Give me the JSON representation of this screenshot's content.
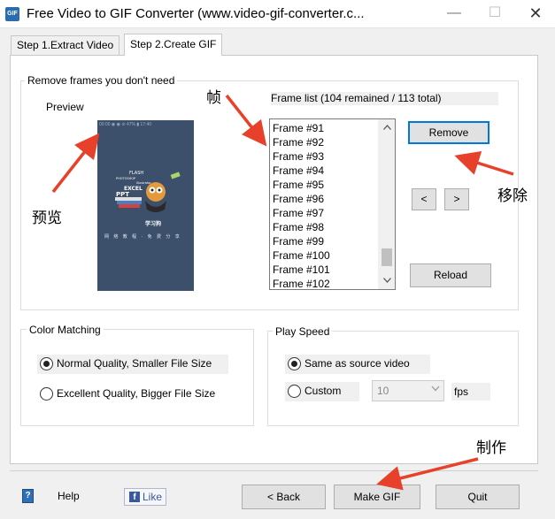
{
  "window": {
    "title": "Free Video to GIF Converter (www.video-gif-converter.c...",
    "app_icon": "GIF",
    "min": "—",
    "max": "☐",
    "close": "✕"
  },
  "tabs": [
    {
      "label": "Step 1.Extract Video",
      "active": false
    },
    {
      "label": "Step 2.Create GIF",
      "active": true
    }
  ],
  "frames_group": {
    "legend": "Remove frames you don't need",
    "preview_label": "Preview",
    "frame_list_label": "Frame list (104 remained / 113 total)",
    "frames": [
      "Frame #91",
      "Frame #92",
      "Frame #93",
      "Frame #94",
      "Frame #95",
      "Frame #96",
      "Frame #97",
      "Frame #98",
      "Frame #99",
      "Frame #100",
      "Frame #101",
      "Frame #102"
    ],
    "remove_button": "Remove",
    "prev_button": "<",
    "next_button": ">",
    "reload_button": "Reload",
    "preview_image": {
      "status_text": "00:00 ◉ ◉          ⊘ 47%  ▮ 17:40",
      "art_lines": [
        "FLASH",
        "PHOTOSHOP",
        "illustrator",
        "EXCEL",
        "PPT",
        "学习狗"
      ],
      "footer_text": "网 络 教 程 · 免 费 分 享"
    }
  },
  "color_group": {
    "legend": "Color Matching",
    "options": [
      {
        "label": "Normal Quality, Smaller File Size",
        "checked": true
      },
      {
        "label": "Excellent Quality, Bigger File Size",
        "checked": false
      }
    ]
  },
  "speed_group": {
    "legend": "Play Speed",
    "options": [
      {
        "label": "Same as source video",
        "checked": true
      },
      {
        "label": "Custom",
        "checked": false
      }
    ],
    "fps_value": "10",
    "fps_unit": "fps"
  },
  "footer": {
    "help_label": "Help",
    "help_icon": "?",
    "like_label": "Like",
    "like_icon": "f",
    "back_button": "< Back",
    "make_gif_button": "Make GIF",
    "quit_button": "Quit"
  },
  "annotations": {
    "frame": "帧",
    "preview": "预览",
    "remove": "移除",
    "make": "制作"
  },
  "colors": {
    "accent_focus": "#0078d7",
    "annotation_arrow": "#e8412b",
    "preview_bg": "#3c4f6b"
  }
}
